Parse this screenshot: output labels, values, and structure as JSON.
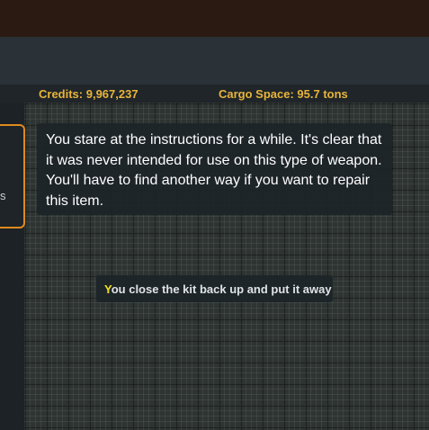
{
  "stats": {
    "credits": "Credits: 9,967,237",
    "cargo_space": "Cargo Space:  95.7 tons"
  },
  "side_panel": {
    "visible_text": "s"
  },
  "message": {
    "text": "You stare at the instructions for a while. It's clear that it was never intended for use on this type of weapon. You'll have to find another way if you want to repair this item."
  },
  "toast": {
    "initial": "Y",
    "rest": "ou close the kit back up and put it away"
  },
  "colors": {
    "accent_gold": "#e8b43a",
    "panel_border_orange": "#e08a1e",
    "toast_initial_yellow": "#f2e11f"
  }
}
